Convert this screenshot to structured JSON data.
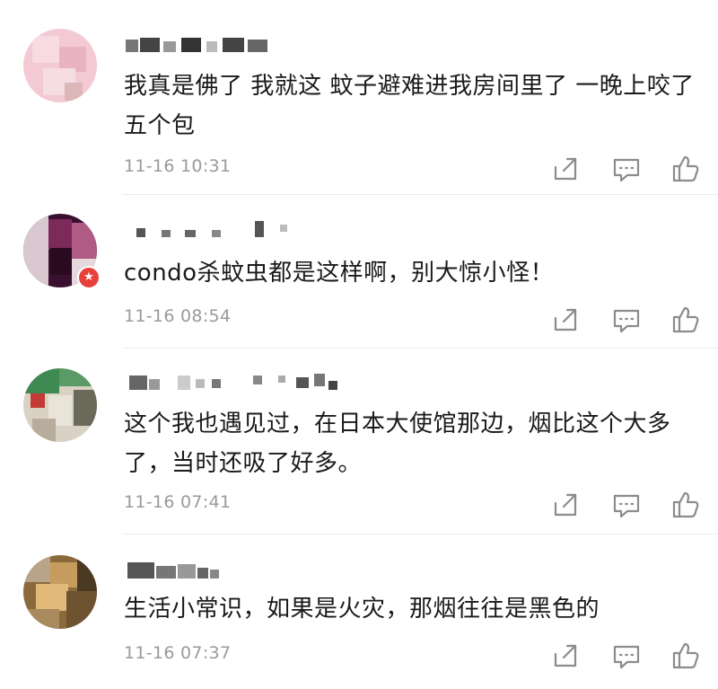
{
  "comments": [
    {
      "text": "我真是佛了 我就这 蚊子避难进我房间里了 一晚上咬了五个包",
      "time": "11-16 10:31",
      "colors": [
        "#f3c9d3",
        "#e9b3c1",
        "#f6dde3",
        "#dcb7b8"
      ]
    },
    {
      "text": "condo杀蚊虫都是这样啊，别大惊小怪！",
      "time": "11-16 08:54",
      "colors": [
        "#4a1238",
        "#7b2a5a",
        "#2a0a20",
        "#b05a86"
      ]
    },
    {
      "text": "这个我也遇见过，在日本大使馆那边，烟比这个大多了，当时还吸了好多。",
      "time": "11-16 07:41",
      "colors": [
        "#3f8a52",
        "#c33a36",
        "#d9d1c4",
        "#6a6a5a"
      ]
    },
    {
      "text": "生活小常识，如果是火灾，那烟往往是黑色的",
      "time": "11-16 07:37",
      "colors": [
        "#8a6a3a",
        "#c69c5e",
        "#4a3a22",
        "#e0b878"
      ]
    }
  ],
  "icons": {
    "share": "share-icon",
    "reply": "reply-icon",
    "like": "like-icon"
  },
  "accent": {
    "badge": "#e8413c",
    "time": "#9a9a9a",
    "icon": "#8c8c8c"
  }
}
